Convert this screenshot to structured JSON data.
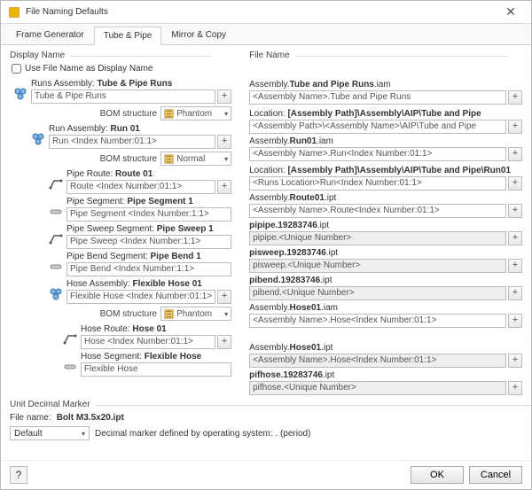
{
  "window": {
    "title": "File Naming Defaults"
  },
  "tabs": [
    "Frame Generator",
    "Tube & Pipe",
    "Mirror & Copy"
  ],
  "active_tab": 1,
  "left_heading": "Display Name",
  "right_heading": "File Name",
  "checkbox_label": "Use File Name as Display Name",
  "bom_label": "BOM structure",
  "bom_phantom": "Phantom",
  "bom_normal": "Normal",
  "items": [
    {
      "left_pre": "Runs Assembly: ",
      "left_bold": "Tube & Pipe Runs",
      "left_val": "Tube & Pipe Runs",
      "right1_pre": "Assembly.",
      "right1_bold": "Tube and Pipe Runs",
      "right1_suf": ".iam",
      "right1_val": "<Assembly Name>.Tube and Pipe Runs",
      "right2_pre": "Location: ",
      "right2_bold": "[Assembly Path]\\Assembly\\AIP\\Tube and Pipe",
      "right2_val": "<Assembly Path>\\<Assembly Name>\\AIP\\Tube and Pipe",
      "bom": "phantom",
      "left_plus": true
    },
    {
      "left_pre": "Run Assembly: ",
      "left_bold": "Run 01",
      "left_val": "Run <Index Number:01:1>",
      "right1_pre": "Assembly.",
      "right1_bold": "Run01",
      "right1_suf": ".iam",
      "right1_val": "<Assembly Name>.Run<Index Number:01:1>",
      "right2_pre": "Location: ",
      "right2_bold": "[Assembly Path]\\Assembly\\AIP\\Tube and Pipe\\Run01",
      "right2_val": "<Runs Location>Run<Index Number:01:1>",
      "bom": "normal",
      "left_plus": true
    },
    {
      "left_pre": "Pipe Route: ",
      "left_bold": "Route 01",
      "left_val": "Route <Index Number:01:1>",
      "right1_pre": "Assembly.",
      "right1_bold": "Route01",
      "right1_suf": ".ipt",
      "right1_val": "<Assembly Name>.Route<Index Number:01:1>",
      "left_plus": true
    },
    {
      "left_pre": "Pipe Segment: ",
      "left_bold": "Pipe Segment 1",
      "left_val": "Pipe Segment <Index Number:1:1>",
      "right1_pre": "",
      "right1_bold": "pipipe.19283746",
      "right1_suf": ".ipt",
      "right1_val": "pipipe.<Unique Number>",
      "left_plus": false,
      "right_ro": true
    },
    {
      "left_pre": "Pipe Sweep Segment: ",
      "left_bold": "Pipe Sweep 1",
      "left_val": "Pipe Sweep <Index Number:1:1>",
      "right1_pre": "",
      "right1_bold": "pisweep.19283746",
      "right1_suf": ".ipt",
      "right1_val": "pisweep.<Unique Number>",
      "left_plus": false,
      "right_ro": true
    },
    {
      "left_pre": "Pipe Bend Segment: ",
      "left_bold": "Pipe Bend 1",
      "left_val": "Pipe Bend <Index Number:1:1>",
      "right1_pre": "",
      "right1_bold": "pibend.19283746",
      "right1_suf": ".ipt",
      "right1_val": "pibend.<Unique Number>",
      "left_plus": false,
      "right_ro": true
    },
    {
      "left_pre": "Hose Assembly: ",
      "left_bold": "Flexible Hose 01",
      "left_val": "Flexible Hose <Index Number:01:1>",
      "right1_pre": "Assembly.",
      "right1_bold": "Hose01",
      "right1_suf": ".iam",
      "right1_val": "<Assembly Name>.Hose<Index Number:01:1>",
      "bom": "phantom",
      "left_plus": true
    },
    {
      "left_pre": "Hose Route: ",
      "left_bold": "Hose 01",
      "left_val": "Hose <Index Number:01:1>",
      "right1_pre": "Assembly.",
      "right1_bold": "Hose01",
      "right1_suf": ".ipt",
      "right1_val": "<Assembly Name>.Hose<Index Number:01:1>",
      "left_plus": true,
      "right_ro": true
    },
    {
      "left_pre": "Hose Segment: ",
      "left_bold": "Flexible Hose",
      "left_val": "Flexible Hose",
      "right1_pre": "",
      "right1_bold": "pifhose.19283746",
      "right1_suf": ".ipt",
      "right1_val": "pifhose.<Unique Number>",
      "left_plus": false,
      "right_ro": true
    }
  ],
  "decimal": {
    "legend": "Unit Decimal Marker",
    "filename_label": "File name:",
    "filename_value": "Bolt M3.5x20.ipt",
    "select_value": "Default",
    "desc": "Decimal marker defined by operating system: . (period)"
  },
  "buttons": {
    "ok": "OK",
    "cancel": "Cancel",
    "help": "?"
  }
}
